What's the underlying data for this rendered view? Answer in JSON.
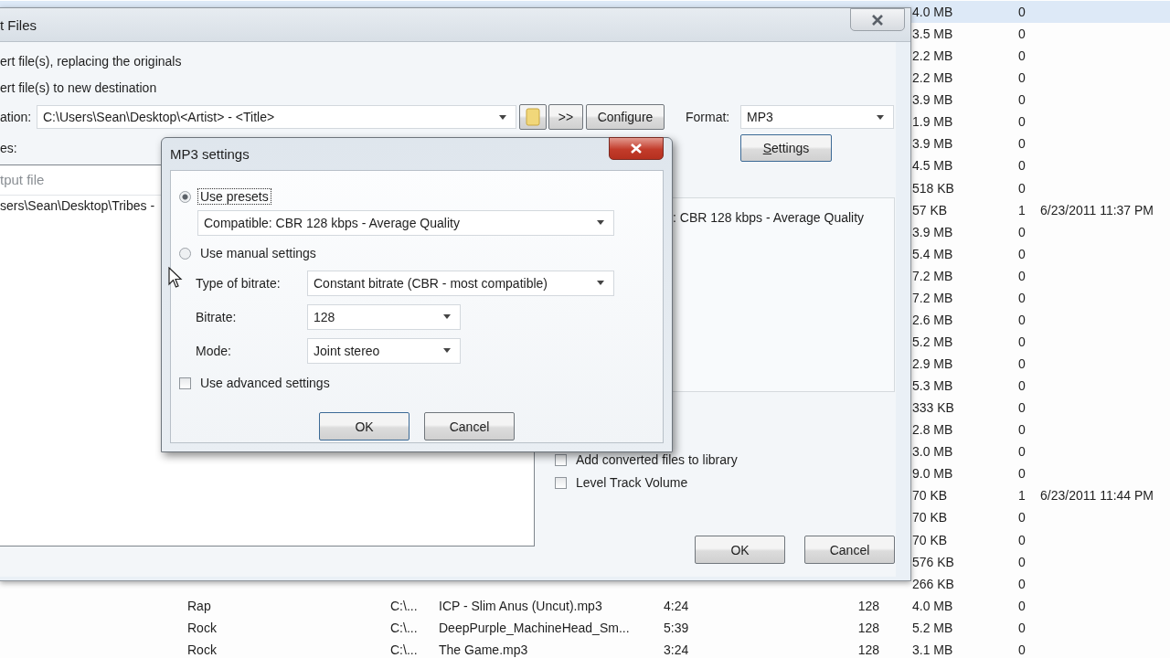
{
  "background_list": {
    "rows": [
      {
        "size": "4.0 MB",
        "count": "0",
        "selected": true
      },
      {
        "size": "3.5 MB",
        "count": "0",
        "selected": false
      },
      {
        "size": "2.2 MB",
        "count": "0",
        "selected": false
      },
      {
        "size": "2.2 MB",
        "count": "0",
        "selected": false
      },
      {
        "size": "3.9 MB",
        "count": "0",
        "selected": false
      },
      {
        "size": "1.9 MB",
        "count": "0",
        "selected": false
      },
      {
        "size": "3.9 MB",
        "count": "0",
        "selected": false
      },
      {
        "size": "4.5 MB",
        "count": "0",
        "selected": false
      },
      {
        "size": "518 KB",
        "count": "0",
        "selected": false
      },
      {
        "size": "57 KB",
        "count": "1",
        "date": "6/23/2011 11:37 PM",
        "selected": false
      },
      {
        "size": "3.9 MB",
        "count": "0",
        "selected": false
      },
      {
        "size": "5.4 MB",
        "count": "0",
        "selected": false
      },
      {
        "size": "7.2 MB",
        "count": "0",
        "selected": false
      },
      {
        "size": "7.2 MB",
        "count": "0",
        "selected": false
      },
      {
        "size": "2.6 MB",
        "count": "0",
        "selected": false
      },
      {
        "size": "5.2 MB",
        "count": "0",
        "selected": false
      },
      {
        "size": "2.9 MB",
        "count": "0",
        "selected": false
      },
      {
        "size": "5.3 MB",
        "count": "0",
        "selected": false
      },
      {
        "size": "333 KB",
        "count": "0",
        "selected": false
      },
      {
        "size": "2.8 MB",
        "count": "0",
        "selected": false
      },
      {
        "size": "3.0 MB",
        "count": "0",
        "selected": false
      },
      {
        "size": "9.0 MB",
        "count": "0",
        "selected": false
      },
      {
        "size": "70 KB",
        "count": "1",
        "date": "6/23/2011 11:44 PM",
        "selected": false
      },
      {
        "size": "70 KB",
        "count": "0",
        "selected": false
      },
      {
        "size": "70 KB",
        "count": "0",
        "selected": false
      },
      {
        "size": "576 KB",
        "count": "0",
        "selected": false
      },
      {
        "size": "266 KB",
        "count": "0",
        "selected": false
      },
      {
        "genre": "Rap",
        "path": "C:\\...",
        "file": "ICP - Slim Anus (Uncut).mp3",
        "time": "4:24",
        "bitrate": "128",
        "size": "4.0 MB",
        "count": "0",
        "selected": false
      },
      {
        "genre": "Rock",
        "path": "C:\\...",
        "file": "DeepPurple_MachineHead_Sm...",
        "time": "5:39",
        "bitrate": "128",
        "size": "5.2 MB",
        "count": "0",
        "selected": false
      },
      {
        "genre": "Rock",
        "path": "C:\\...",
        "file": "The Game.mp3",
        "time": "3:24",
        "bitrate": "128",
        "size": "3.1 MB",
        "count": "0",
        "selected": false
      }
    ]
  },
  "convert_window": {
    "title": "t Files",
    "options": [
      "ert file(s), replacing the originals",
      "ert file(s) to new destination"
    ],
    "destination_label": "ation:",
    "destination": "C:\\Users\\Sean\\Desktop\\<Artist> - <Title>",
    "more_button": ">>",
    "configure_button": "Configure",
    "format_label": "Format:",
    "format": "MP3",
    "files_label": "es:",
    "settings_button": "Settings",
    "file_list": {
      "header": "tput file",
      "rows": [
        "sers\\Sean\\Desktop\\Tribes -"
      ]
    },
    "preset_summary": ": CBR 128 kbps - Average Quality",
    "checkboxes": [
      {
        "label": "Add converted files to library",
        "checked": false
      },
      {
        "label": "Level Track Volume",
        "checked": false
      }
    ],
    "buttons": [
      "OK",
      "Cancel"
    ]
  },
  "mp3_dialog": {
    "title": "MP3 settings",
    "modes": [
      {
        "label": "Use presets",
        "selected": true
      },
      {
        "label": "Use manual settings",
        "selected": false
      }
    ],
    "preset": "Compatible: CBR 128 kbps - Average Quality",
    "fields": [
      {
        "label": "Type of bitrate:",
        "value": "Constant bitrate (CBR - most compatible)"
      },
      {
        "label": "Bitrate:",
        "value": "128"
      },
      {
        "label": "Mode:",
        "value": "Joint stereo"
      }
    ],
    "advanced": {
      "label": "Use advanced settings",
      "checked": false
    },
    "buttons": [
      "OK",
      "Cancel"
    ]
  }
}
